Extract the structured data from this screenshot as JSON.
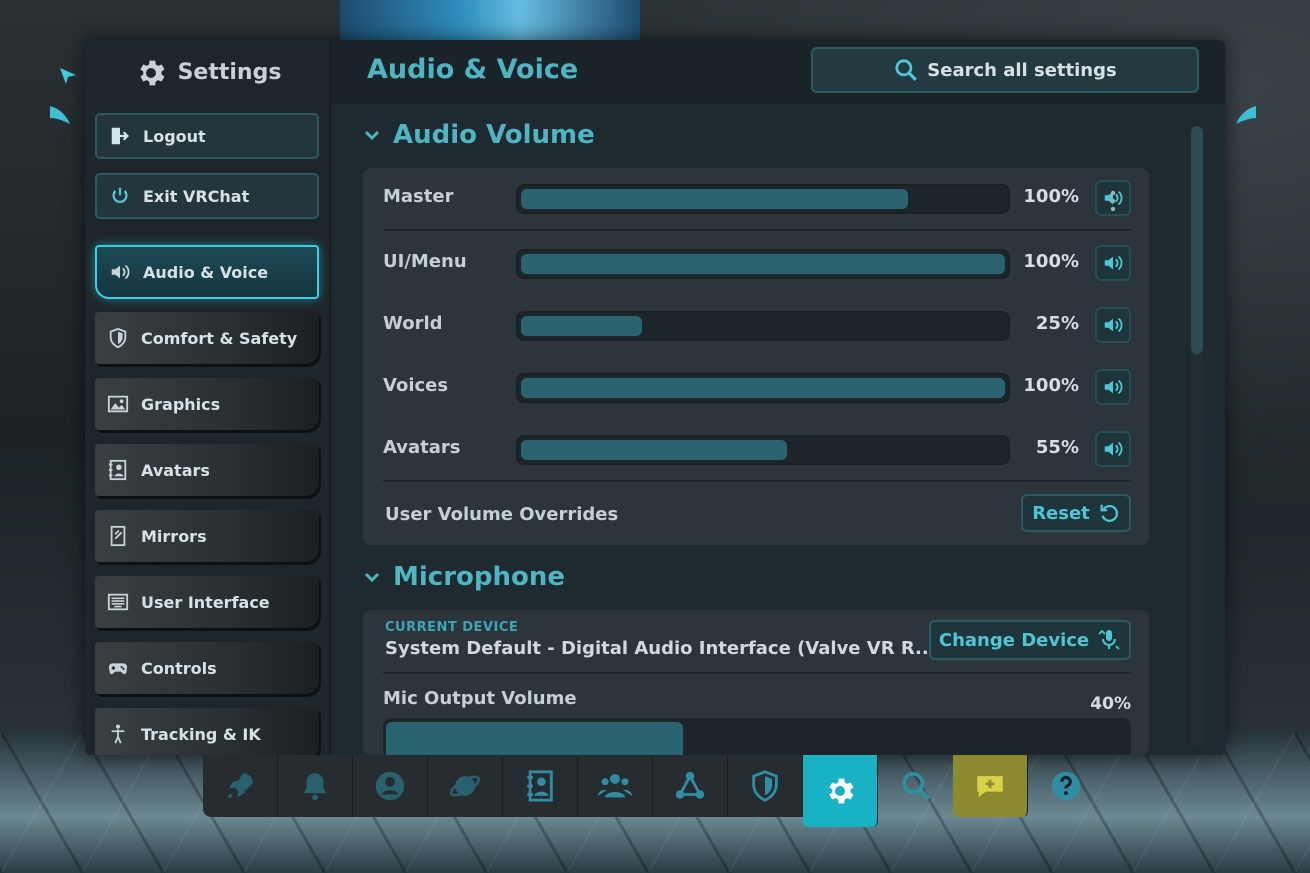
{
  "app": {
    "title": "Settings",
    "icon": "gear-icon"
  },
  "sidebar": {
    "top_buttons": [
      {
        "label": "Logout",
        "icon": "logout-icon"
      },
      {
        "label": "Exit VRChat",
        "icon": "power-icon"
      }
    ],
    "items": [
      {
        "label": "Audio & Voice",
        "icon": "speaker-icon",
        "active": true
      },
      {
        "label": "Comfort & Safety",
        "icon": "shield-icon"
      },
      {
        "label": "Graphics",
        "icon": "image-icon"
      },
      {
        "label": "Avatars",
        "icon": "avatar-card-icon"
      },
      {
        "label": "Mirrors",
        "icon": "mirror-icon"
      },
      {
        "label": "User Interface",
        "icon": "keyboard-icon"
      },
      {
        "label": "Controls",
        "icon": "gamepad-icon"
      },
      {
        "label": "Tracking & IK",
        "icon": "body-tracking-icon"
      }
    ]
  },
  "header": {
    "page_title": "Audio & Voice",
    "search_label": "Search all settings"
  },
  "audio_volume": {
    "title": "Audio Volume",
    "rows": [
      {
        "label": "Master",
        "value": 0.8,
        "percent": "100%"
      },
      {
        "label": "UI/Menu",
        "value": 1.0,
        "percent": "100%"
      },
      {
        "label": "World",
        "value": 0.25,
        "percent": "25%"
      },
      {
        "label": "Voices",
        "value": 1.0,
        "percent": "100%"
      },
      {
        "label": "Avatars",
        "value": 0.55,
        "percent": "55%"
      }
    ],
    "overrides_label": "User Volume Overrides",
    "reset_label": "Reset"
  },
  "microphone": {
    "title": "Microphone",
    "current_device_label": "CURRENT DEVICE",
    "current_device_name": "System Default - Digital Audio Interface (Valve VR R...",
    "change_device_label": "Change Device",
    "mic_output_label": "Mic Output Volume",
    "mic_output_percent": "40%",
    "mic_output_value": 0.4
  },
  "dock": [
    {
      "icon": "rocket-icon"
    },
    {
      "icon": "bell-icon"
    },
    {
      "icon": "profile-icon"
    },
    {
      "icon": "planet-icon"
    },
    {
      "icon": "avatar-card-icon"
    },
    {
      "icon": "friends-icon"
    },
    {
      "icon": "groups-icon"
    },
    {
      "icon": "shield-icon"
    },
    {
      "icon": "settings-gear-icon",
      "active": true
    },
    {
      "icon": "search-icon"
    },
    {
      "icon": "chat-add-icon"
    },
    {
      "icon": "help-icon"
    }
  ],
  "colors": {
    "accent": "#4fb5c3",
    "active_glow": "#3ad0e6",
    "bar_fill": "#2a6471",
    "dock_active": "#18b2c4",
    "dock_yellow": "#8c8a2e"
  }
}
